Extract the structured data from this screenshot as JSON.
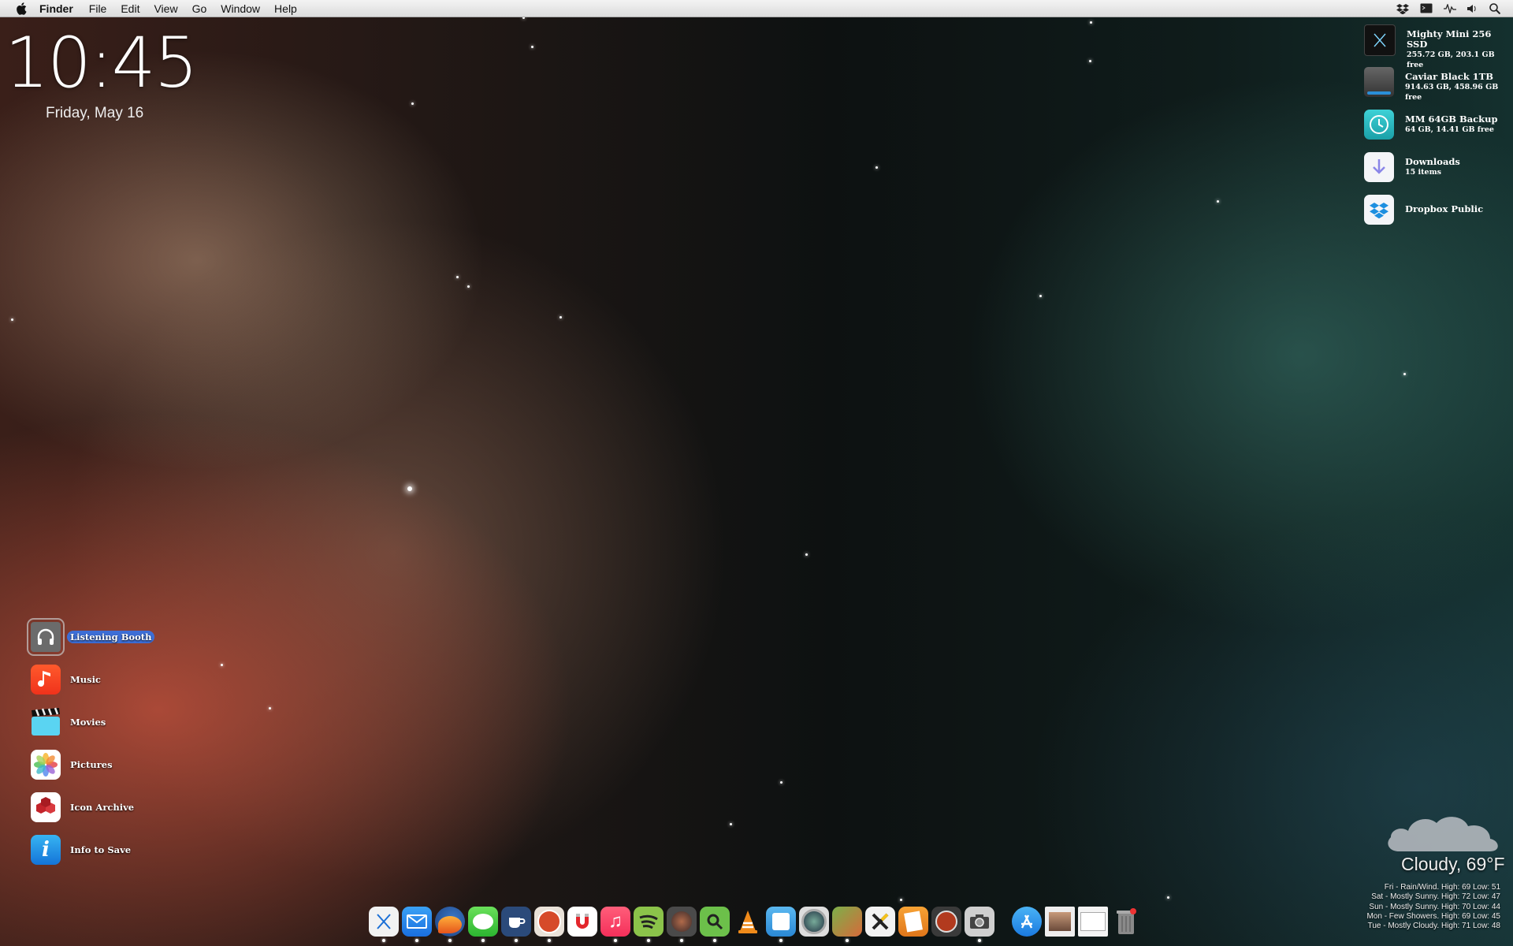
{
  "menubar": {
    "app_name": "Finder",
    "items": [
      "File",
      "Edit",
      "View",
      "Go",
      "Window",
      "Help"
    ]
  },
  "clock": {
    "time": "10:45",
    "date": "Friday, May 16"
  },
  "drives": [
    {
      "name": "Mighty Mini 256 SSD",
      "sub": "255.72 GB, 203.1 GB free",
      "icon": "ssd-drive-icon"
    },
    {
      "name": "Caviar Black 1TB",
      "sub": "914.63 GB, 458.96 GB free",
      "icon": "hard-drive-icon"
    },
    {
      "name": "MM 64GB Backup",
      "sub": "64 GB, 14.41 GB free",
      "icon": "time-machine-icon"
    },
    {
      "name": "Downloads",
      "sub": "15 items",
      "icon": "downloads-folder-icon"
    },
    {
      "name": "Dropbox Public",
      "sub": "",
      "icon": "dropbox-folder-icon"
    }
  ],
  "left_icons": [
    {
      "label": "Listening Booth",
      "icon": "headphones-icon"
    },
    {
      "label": "Music",
      "icon": "music-note-icon"
    },
    {
      "label": "Movies",
      "icon": "clapperboard-icon"
    },
    {
      "label": "Pictures",
      "icon": "photos-flower-icon"
    },
    {
      "label": "Icon Archive",
      "icon": "cubes-icon"
    },
    {
      "label": "Info to Save",
      "icon": "info-icon"
    }
  ],
  "weather": {
    "current": "Cloudy, 69°F",
    "forecast": [
      "Fri - Rain/Wind. High: 69 Low: 51",
      "Sat - Mostly Sunny. High: 72 Low: 47",
      "Sun - Mostly Sunny. High: 70 Low: 44",
      "Mon - Few Showers. High: 69 Low: 45",
      "Tue - Mostly Cloudy. High: 71 Low: 48"
    ]
  },
  "dock": {
    "apps": [
      "xcode-icon",
      "mail-icon",
      "firefox-icon",
      "messages-icon",
      "coffee-icon",
      "stop-sign-icon",
      "magnet-icon",
      "itunes-icon",
      "spotify-icon",
      "audio-hijack-icon",
      "search-app-icon",
      "vlc-icon",
      "dashboard-icon",
      "camera-lens-icon",
      "photo-app-icon",
      "x-app-icon",
      "pages-icon",
      "recorder-icon",
      "screenshot-icon"
    ],
    "right": [
      "app-store-icon",
      "preview-icon",
      "finder-window-icon",
      "trash-icon"
    ]
  }
}
